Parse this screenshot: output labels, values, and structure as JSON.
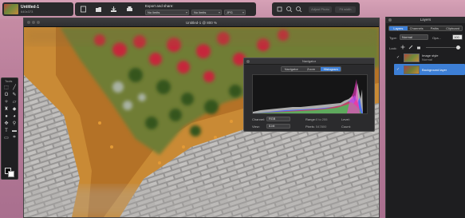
{
  "document": {
    "name": "Untitled-1",
    "size": "640x373",
    "window_title": "Untitled-1 @ 800 %"
  },
  "export_bar": {
    "title": "Export and share:",
    "selects": [
      "No limits",
      "No limits",
      "JPG"
    ]
  },
  "right_toolbar": {
    "buttons": [
      "Adjust Photo",
      "Fit width"
    ]
  },
  "tools_panel": {
    "title": "Tools",
    "tools": [
      "marquee-icon",
      "brush-icon",
      "lasso-icon",
      "pencil-icon",
      "magic-wand-icon",
      "eraser-icon",
      "stamp-icon",
      "bucket-icon",
      "dodge-icon",
      "blur-icon",
      "move-icon",
      "zoom-icon",
      "type-icon",
      "pen-icon",
      "shape-icon",
      "crop-icon"
    ]
  },
  "navigator": {
    "title": "Navigator",
    "tabs": [
      "Navigator",
      "Zoom",
      "Histogram"
    ],
    "active_tab": "Histogram",
    "channel_label": "Channel:",
    "channel_value": "RGB",
    "view_label": "View:",
    "view_value": "8-bit",
    "range_label": "Range:",
    "range_value": "0 to 255",
    "level_label": "Level:",
    "pixels_label": "Pixels:",
    "pixels_value": "547800",
    "count_label": "Count:"
  },
  "layers_panel": {
    "title": "Layers",
    "tabs": [
      "Layers",
      "Channels",
      "Paths",
      "Clipboard"
    ],
    "active_tab": "Layers",
    "type_label": "Type:",
    "type_value": "Normal",
    "opacity_label": "Opa...",
    "opacity_value": "100",
    "lock_label": "Lock:",
    "layers": [
      {
        "name": "Image style",
        "sub": "Normal",
        "visible": true,
        "selected": false
      },
      {
        "name": "Background layer",
        "sub": "",
        "visible": true,
        "selected": true
      }
    ]
  },
  "colors": {
    "accent": "#3d7fd6",
    "panel": "#1e1e20",
    "toolbar": "#2a2a2c"
  }
}
